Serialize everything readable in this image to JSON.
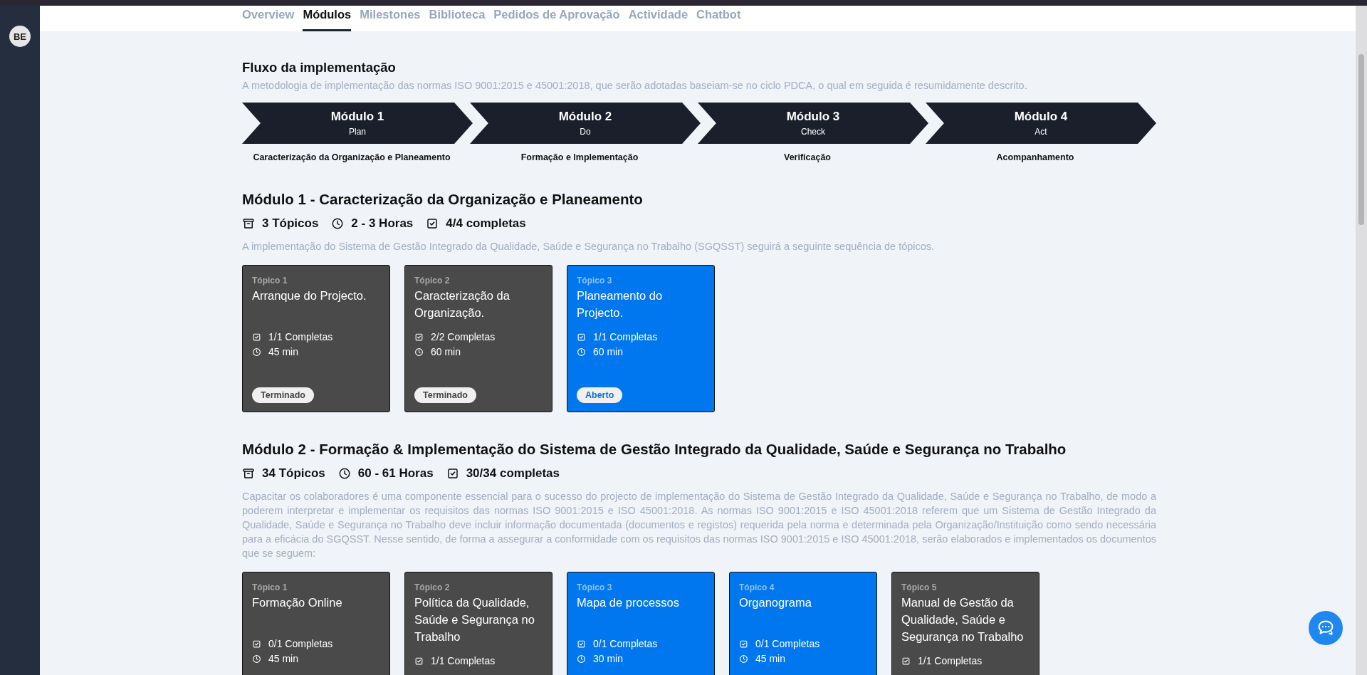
{
  "user": {
    "initials": "BE"
  },
  "tabs": [
    {
      "label": "Overview",
      "selected": false
    },
    {
      "label": "Módulos",
      "selected": true
    },
    {
      "label": "Milestones",
      "selected": false
    },
    {
      "label": "Biblioteca",
      "selected": false
    },
    {
      "label": "Pedidos de Aprovação",
      "selected": false
    },
    {
      "label": "Actividade",
      "selected": false
    },
    {
      "label": "Chatbot",
      "selected": false
    }
  ],
  "flow": {
    "title": "Fluxo da implementação",
    "description": "A metodologia de implementação das normas ISO 9001:2015 e 45001:2018, que serão adotadas baseiam-se no ciclo PDCA, o qual em seguida é resumidamente descrito.",
    "steps": [
      {
        "title": "Módulo 1",
        "phase": "Plan",
        "caption": "Caracterização da Organização e Planeamento"
      },
      {
        "title": "Módulo 2",
        "phase": "Do",
        "caption": "Formação e Implementação"
      },
      {
        "title": "Módulo 3",
        "phase": "Check",
        "caption": "Verificação"
      },
      {
        "title": "Módulo 4",
        "phase": "Act",
        "caption": "Acompanhamento"
      }
    ]
  },
  "modules": [
    {
      "title": "Módulo 1 - Caracterização da Organização e Planeamento",
      "topics_count": "3 Tópicos",
      "hours": "2 - 3 Horas",
      "completed": "4/4 completas",
      "description": "A implementação do Sistema de Gestão Integrado da Qualidade, Saúde e Segurança no Trabalho (SGQSST) seguirá a seguinte sequência de tópicos.",
      "topics": [
        {
          "label": "Tópico 1",
          "title": "Arranque do Projecto.",
          "kind": "finished",
          "progress": "1/1 Completas",
          "duration": "45 min",
          "badge": "Terminado"
        },
        {
          "label": "Tópico 2",
          "title": "Caracterização da Organização.",
          "kind": "finished",
          "progress": "2/2 Completas",
          "duration": "60 min",
          "badge": "Terminado"
        },
        {
          "label": "Tópico 3",
          "title": "Planeamento do Projecto.",
          "kind": "open",
          "progress": "1/1 Completas",
          "duration": "60 min",
          "badge": "Aberto"
        }
      ]
    },
    {
      "title": "Módulo 2 - Formação & Implementação do Sistema de Gestão Integrado da Qualidade, Saúde e Segurança no Trabalho",
      "topics_count": "34 Tópicos",
      "hours": "60 - 61 Horas",
      "completed": "30/34 completas",
      "description": "Capacitar os colaboradores é uma componente essencial para o sucesso do projecto de implementação do Sistema de Gestão Integrado da Qualidade, Saúde e Segurança no Trabalho, de modo a poderem interpretar e implementar os requisitos das normas ISO 9001:2015 e ISO 45001:2018. As normas ISO 9001:2015 e ISO 45001:2018 referem que um Sistema de Gestão Integrado da Qualidade, Saúde e Segurança no Trabalho deve incluir informação documentada (documentos e registos) requerida pela norma e determinada pela Organização/Instituição como sendo necessária para a eficácia do SGQSST. Nesse sentido, de forma a assegurar a conformidade com os requisitos das normas ISO 9001:2015 e ISO 45001:2018, serão elaborados e implementados os documentos que se seguem:",
      "topics": [
        {
          "label": "Tópico 1",
          "title": "Formação Online",
          "kind": "finished",
          "progress": "0/1 Completas",
          "duration": "45 min"
        },
        {
          "label": "Tópico 2",
          "title": "Política da Qualidade, Saúde e Segurança no Trabalho",
          "kind": "finished",
          "progress": "1/1 Completas"
        },
        {
          "label": "Tópico 3",
          "title": "Mapa de processos",
          "kind": "open",
          "progress": "0/1 Completas",
          "duration": "30 min"
        },
        {
          "label": "Tópico 4",
          "title": "Organograma",
          "kind": "open",
          "progress": "0/1 Completas",
          "duration": "45 min"
        },
        {
          "label": "Tópico 5",
          "title": "Manual de Gestão da Qualidade, Saúde e Segurança no Trabalho",
          "kind": "finished",
          "progress": "1/1 Completas"
        }
      ]
    }
  ]
}
